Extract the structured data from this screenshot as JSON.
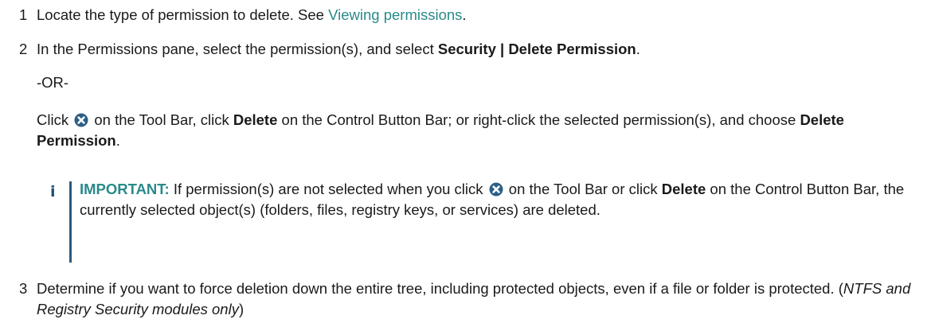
{
  "steps": [
    {
      "number": "1",
      "text": "Locate the type of permission to delete. See ",
      "link": "Viewing permissions",
      "end": "."
    },
    {
      "number": "2",
      "text": "In the Permissions pane, select the permission(s), and select ",
      "bold": "Security | Delete Permission",
      "end": ".",
      "or": "-OR-",
      "alt": {
        "t1": "Click ",
        "t2": " on the Tool Bar, click ",
        "b1": "Delete",
        "t3": " on the Control Button Bar; or right-click the selected permission(s), and choose ",
        "b2": "Delete Permission",
        "t4": "."
      }
    },
    {
      "number": "3",
      "text": "Determine if you want to force deletion down the entire tree, including protected objects, even if a file or folder is protected. (",
      "italic": "NTFS and Registry Security modules only",
      "end": ")"
    }
  ],
  "note": {
    "icon": "i",
    "label": "IMPORTANT:",
    "t1": " If permission(s) are not selected when you click ",
    "t2": " on the Tool Bar or click ",
    "bold": "Delete",
    "t3": " on the Control Button Bar, the currently selected object(s) (folders, files, registry keys, or services) are deleted."
  },
  "colors": {
    "link": "#2a8a8a",
    "important_label": "#2a8a8a",
    "note_icon": "#1f4e72",
    "note_bar": "#2d5a7a",
    "delete_icon": "#2d5f86"
  },
  "icons": {
    "delete": "circle-x-icon",
    "note": "info-icon"
  }
}
